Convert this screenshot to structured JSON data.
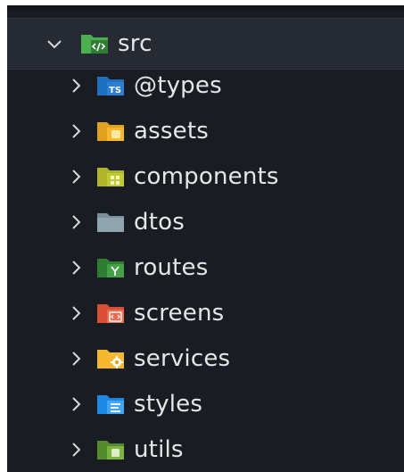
{
  "explorer": {
    "root": {
      "label": "src",
      "expanded": true,
      "icon": "folder-src-icon",
      "color": "#4caf50"
    },
    "items": [
      {
        "label": "@types",
        "icon": "folder-typescript-icon",
        "color": "#2d7fd3",
        "badge": "TS"
      },
      {
        "label": "assets",
        "icon": "folder-assets-icon",
        "color": "#f5b82e"
      },
      {
        "label": "components",
        "icon": "folder-components-icon",
        "color": "#c0ca33"
      },
      {
        "label": "dtos",
        "icon": "folder-generic-icon",
        "color": "#90a4ae"
      },
      {
        "label": "routes",
        "icon": "folder-routes-icon",
        "color": "#43a047"
      },
      {
        "label": "screens",
        "icon": "folder-screens-icon",
        "color": "#ef6c50"
      },
      {
        "label": "services",
        "icon": "folder-services-icon",
        "color": "#f5b82e"
      },
      {
        "label": "styles",
        "icon": "folder-styles-icon",
        "color": "#42a5f5"
      },
      {
        "label": "utils",
        "icon": "folder-utils-icon",
        "color": "#7cb342"
      }
    ]
  }
}
